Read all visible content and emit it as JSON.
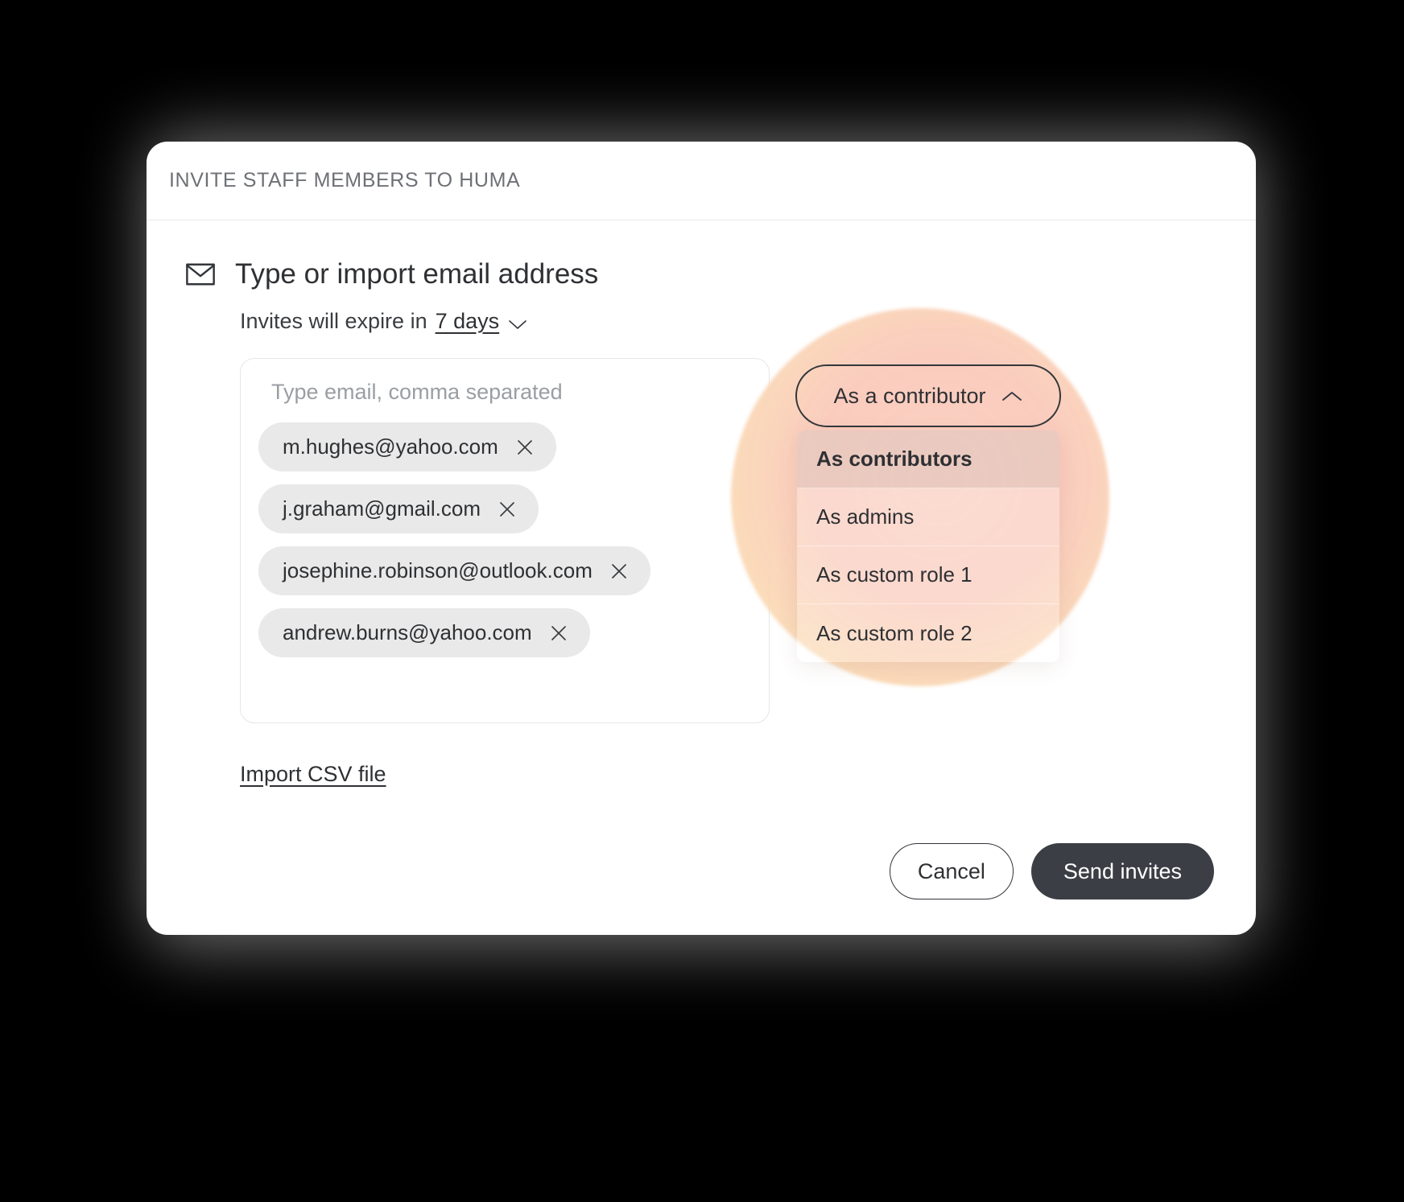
{
  "modal": {
    "title": "INVITE STAFF MEMBERS TO HUMA",
    "section_title": "Type or import email address",
    "mail_icon": "mail-icon",
    "expiry": {
      "label": "Invites will expire in",
      "value": "7 days",
      "chevron_icon": "chevron-down-icon"
    },
    "email_input": {
      "placeholder": "Type email, comma separated",
      "value": "",
      "chips": [
        {
          "email": "m.hughes@yahoo.com",
          "remove_icon": "close-icon"
        },
        {
          "email": "j.graham@gmail.com",
          "remove_icon": "close-icon"
        },
        {
          "email": "josephine.robinson@outlook.com",
          "remove_icon": "close-icon"
        },
        {
          "email": "andrew.burns@yahoo.com",
          "remove_icon": "close-icon"
        }
      ]
    },
    "role_selector": {
      "selected_label": "As a contributor",
      "chevron_icon": "chevron-up-icon",
      "expanded": true,
      "options": [
        {
          "label": "As contributors",
          "selected": true
        },
        {
          "label": "As admins",
          "selected": false
        },
        {
          "label": "As custom role 1",
          "selected": false
        },
        {
          "label": "As custom role 2",
          "selected": false
        }
      ]
    },
    "import_link": "Import CSV file",
    "footer": {
      "cancel_label": "Cancel",
      "send_label": "Send invites"
    }
  },
  "colors": {
    "background": "#000000",
    "surface": "#ffffff",
    "text_primary": "#2e3033",
    "text_muted": "#6e7175",
    "placeholder": "#9a9ea3",
    "chip_background": "#e9e9e9",
    "primary_button": "#3b3f45",
    "highlight_peach": "#fad6c0",
    "highlight_pink": "#facdbe"
  }
}
